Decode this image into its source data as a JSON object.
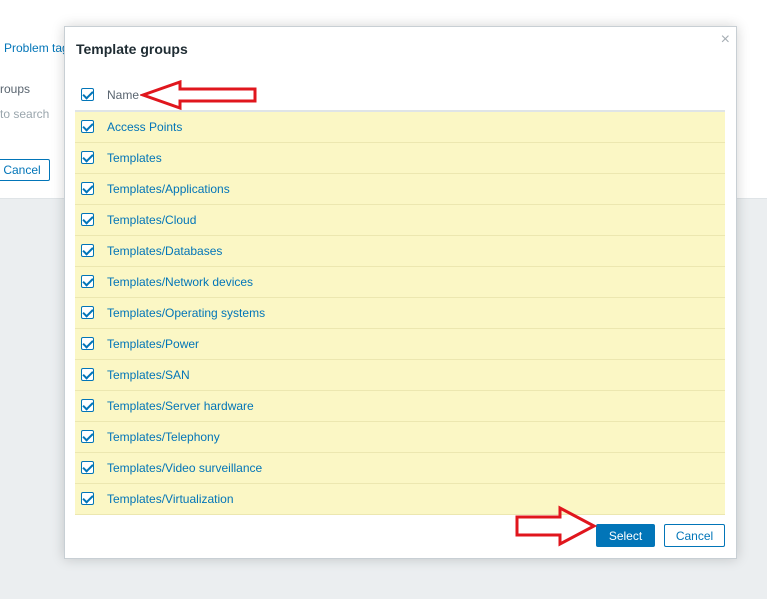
{
  "background": {
    "tab_label": "Problem tag",
    "field_label": "roups",
    "search_placeholder": "to search",
    "cancel_label": "Cancel"
  },
  "modal": {
    "title": "Template groups",
    "close_symbol": "×",
    "header": {
      "name_label": "Name",
      "all_checked": true
    },
    "items": [
      {
        "label": "Access Points",
        "checked": true
      },
      {
        "label": "Templates",
        "checked": true
      },
      {
        "label": "Templates/Applications",
        "checked": true
      },
      {
        "label": "Templates/Cloud",
        "checked": true
      },
      {
        "label": "Templates/Databases",
        "checked": true
      },
      {
        "label": "Templates/Network devices",
        "checked": true
      },
      {
        "label": "Templates/Operating systems",
        "checked": true
      },
      {
        "label": "Templates/Power",
        "checked": true
      },
      {
        "label": "Templates/SAN",
        "checked": true
      },
      {
        "label": "Templates/Server hardware",
        "checked": true
      },
      {
        "label": "Templates/Telephony",
        "checked": true
      },
      {
        "label": "Templates/Video surveillance",
        "checked": true
      },
      {
        "label": "Templates/Virtualization",
        "checked": true
      }
    ],
    "select_label": "Select",
    "cancel_label": "Cancel"
  },
  "colors": {
    "accent": "#0275b8",
    "row_highlight": "#fbf7c5",
    "annotation_arrow": "#e0161d"
  }
}
